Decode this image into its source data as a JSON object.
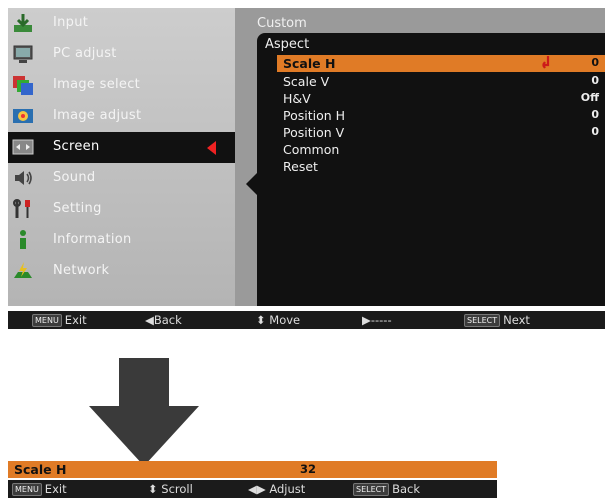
{
  "menu": {
    "items": [
      {
        "id": "input",
        "label": "Input",
        "icon": "input-icon"
      },
      {
        "id": "pc-adjust",
        "label": "PC adjust",
        "icon": "pc-adjust-icon"
      },
      {
        "id": "image-select",
        "label": "Image select",
        "icon": "image-select-icon"
      },
      {
        "id": "image-adjust",
        "label": "Image adjust",
        "icon": "image-adjust-icon"
      },
      {
        "id": "screen",
        "label": "Screen",
        "icon": "screen-icon",
        "selected": true
      },
      {
        "id": "sound",
        "label": "Sound",
        "icon": "sound-icon"
      },
      {
        "id": "setting",
        "label": "Setting",
        "icon": "setting-icon"
      },
      {
        "id": "information",
        "label": "Information",
        "icon": "information-icon"
      },
      {
        "id": "network",
        "label": "Network",
        "icon": "network-icon"
      }
    ]
  },
  "submenu": {
    "title": "Custom",
    "aspect_label": "Aspect",
    "rows": [
      {
        "label": "Scale H",
        "value": "0",
        "selected": true
      },
      {
        "label": "Scale V",
        "value": "0"
      },
      {
        "label": "H&V",
        "value": "Off"
      },
      {
        "label": "Position H",
        "value": "0"
      },
      {
        "label": "Position V",
        "value": "0"
      },
      {
        "label": "Common",
        "value": ""
      },
      {
        "label": "Reset",
        "value": ""
      }
    ]
  },
  "help_top": {
    "exit_key": "MENU",
    "exit": "Exit",
    "back": "◀Back",
    "move": "⬍ Move",
    "next_arrow": "▶-----",
    "select_key": "SELECT",
    "next": "Next"
  },
  "adjust": {
    "label": "Scale H",
    "value": "32"
  },
  "help_bottom": {
    "exit_key": "MENU",
    "exit": "Exit",
    "scroll": "⬍ Scroll",
    "adjust": "◀▶ Adjust",
    "select_key": "SELECT",
    "back": "Back"
  },
  "colors": {
    "highlight": "#e07b26",
    "pointer": "#e22222",
    "panel_dark": "#111111",
    "panel_mid": "#9a9a9a"
  }
}
